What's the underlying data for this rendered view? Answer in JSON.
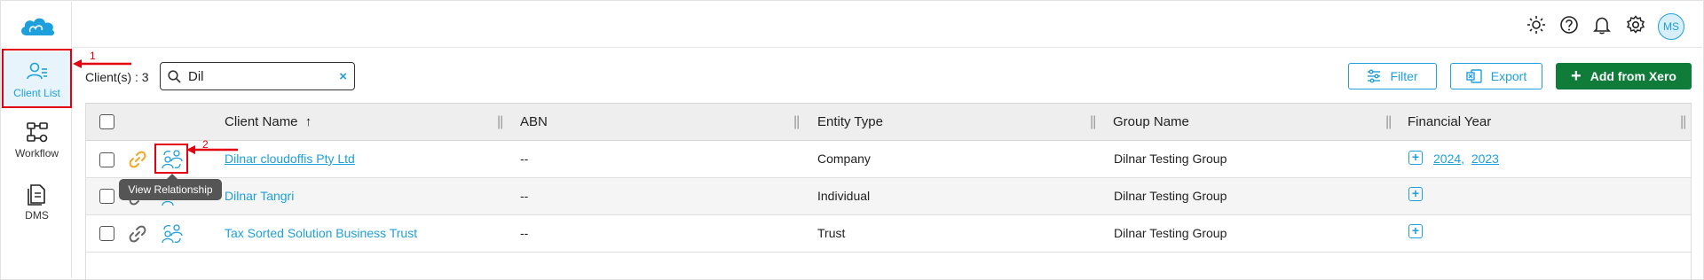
{
  "sidebar": {
    "items": [
      {
        "label": "Client List",
        "icon": "client-list-icon",
        "active": true
      },
      {
        "label": "Workflow",
        "icon": "workflow-icon"
      },
      {
        "label": "DMS",
        "icon": "dms-icon"
      }
    ]
  },
  "topbar": {
    "icons": [
      "theme-sun-icon",
      "help-icon",
      "notification-bell-icon",
      "settings-gear-icon"
    ],
    "avatar_initials": "MS"
  },
  "toolbar": {
    "client_count": "Client(s) : 3",
    "search_value": "Dil",
    "clear_icon": "×",
    "filter_label": "Filter",
    "export_label": "Export",
    "add_label": "Add from Xero"
  },
  "table": {
    "columns": [
      {
        "label": "Client Name",
        "sort": "asc"
      },
      {
        "label": "ABN"
      },
      {
        "label": "Entity Type"
      },
      {
        "label": "Group Name"
      },
      {
        "label": "Financial Year"
      }
    ],
    "sort_indicator": "↑",
    "rows": [
      {
        "client_name": "Dilnar cloudoffis Pty Ltd",
        "abn": "--",
        "entity_type": "Company",
        "group_name": "Dilnar Testing Group",
        "financial_years": [
          "2024",
          "2023"
        ],
        "link_color": "#f5a623"
      },
      {
        "client_name": "Dilnar Tangri",
        "abn": "--",
        "entity_type": "Individual",
        "group_name": "Dilnar Testing Group",
        "financial_years": [],
        "link_color": "#666666"
      },
      {
        "client_name": "Tax Sorted Solution Business Trust",
        "abn": "--",
        "entity_type": "Trust",
        "group_name": "Dilnar Testing Group",
        "financial_years": [],
        "link_color": "#666666"
      }
    ],
    "fy_separator": ","
  },
  "tooltip": "View Relationship",
  "annotations": {
    "step1": "1",
    "step2": "2"
  },
  "colors": {
    "accent": "#1ea0dc",
    "primary_green": "#0f7c3a",
    "annotation_red": "#e3000f"
  }
}
